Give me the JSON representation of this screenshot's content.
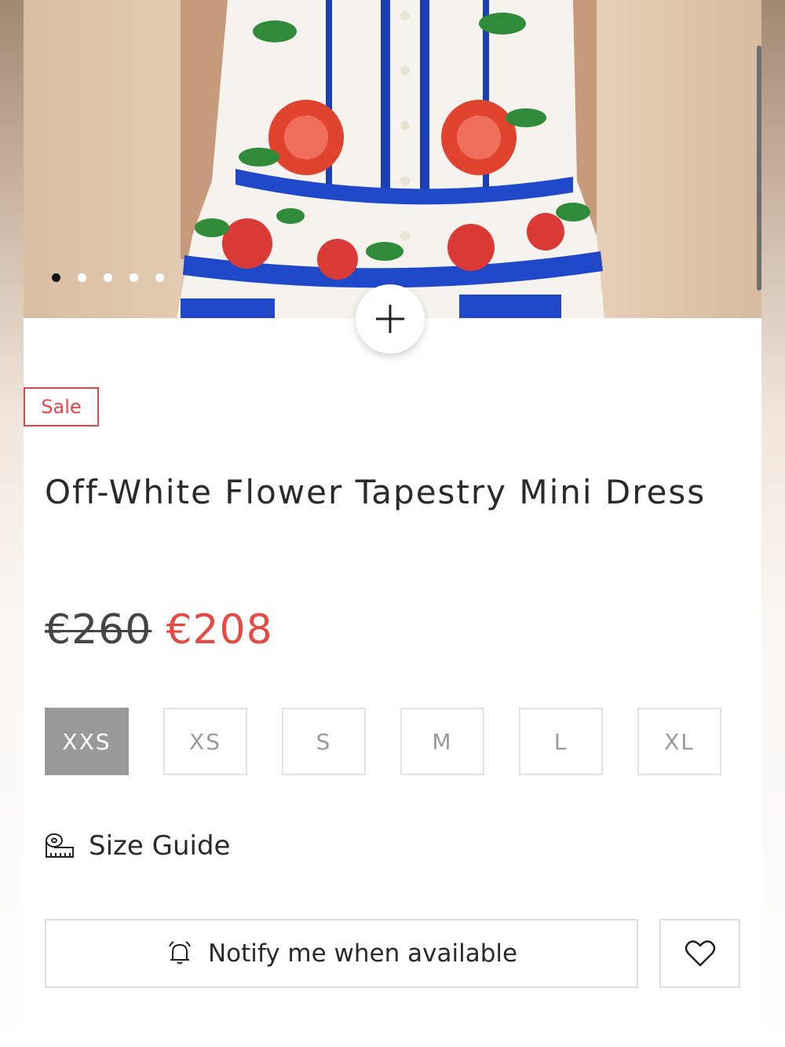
{
  "gallery": {
    "image_alt": "Off-White Flower Tapestry Mini Dress",
    "dots_count": 5,
    "active_dot": 0,
    "zoom_icon": "plus-icon"
  },
  "product": {
    "badge": "Sale",
    "title": "Off-White Flower Tapestry Mini Dress",
    "price_old": "€260",
    "price_new": "€208",
    "sale_color": "#e64a45"
  },
  "sizes": {
    "options": [
      "XXS",
      "XS",
      "S",
      "M",
      "L",
      "XL"
    ],
    "selected": "XXS"
  },
  "size_guide": {
    "label": "Size Guide",
    "icon": "measuring-tape-icon"
  },
  "actions": {
    "notify_label": "Notify me when available",
    "notify_icon": "bell-icon",
    "wishlist_icon": "heart-icon"
  }
}
